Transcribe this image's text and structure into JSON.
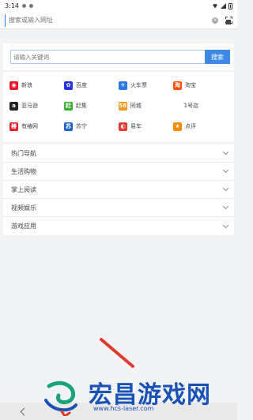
{
  "status_bar": {
    "time": "3:14"
  },
  "address_bar": {
    "placeholder": "搜索或输入网址"
  },
  "search": {
    "placeholder": "请输入关键词",
    "button_label": "搜索"
  },
  "quick_links": [
    [
      {
        "label": "新浪",
        "icon": "sina-weibo-icon",
        "glyph": "◉",
        "color": "#e6162d"
      },
      {
        "label": "百度",
        "icon": "baidu-paw-icon",
        "glyph": "✿",
        "color": "#2932e1"
      },
      {
        "label": "火车票",
        "icon": "train-ticket-icon",
        "glyph": "✈",
        "color": "#2a7ae2"
      },
      {
        "label": "淘宝",
        "icon": "taobao-icon",
        "glyph": "淘",
        "color": "#ff5000"
      }
    ],
    [
      {
        "label": "亚马逊",
        "icon": "amazon-icon",
        "glyph": "a",
        "color": "#222222"
      },
      {
        "label": "赶集",
        "icon": "ganji-icon",
        "glyph": "赶",
        "color": "#3cb034"
      },
      {
        "label": "同城",
        "icon": "58-tongcheng-icon",
        "glyph": "58",
        "color": "#f29c1f"
      },
      {
        "label": "1号店",
        "icon": "",
        "glyph": "",
        "color": ""
      }
    ],
    [
      {
        "label": "有椿网",
        "icon": "youchun-icon",
        "glyph": "椿",
        "color": "#e8202a"
      },
      {
        "label": "苏宁",
        "icon": "suning-icon",
        "glyph": "苏",
        "color": "#1e64c8"
      },
      {
        "label": "易车",
        "icon": "yiche-icon",
        "glyph": "◐",
        "color": "#e03c31"
      },
      {
        "label": "点评",
        "icon": "dianping-icon",
        "glyph": "★",
        "color": "#ff8a00"
      }
    ]
  ],
  "nav_sections": [
    {
      "label": "热门导航"
    },
    {
      "label": "生活购物"
    },
    {
      "label": "掌上阅读"
    },
    {
      "label": "视频娱乐"
    },
    {
      "label": "游戏应用"
    }
  ],
  "watermark": {
    "title": "宏昌游戏网",
    "url": "www.hcs-laser.com"
  },
  "colors": {
    "accent": "#3d8ae6",
    "watermark": "#1a52b5",
    "background": "#f2f3f5"
  }
}
